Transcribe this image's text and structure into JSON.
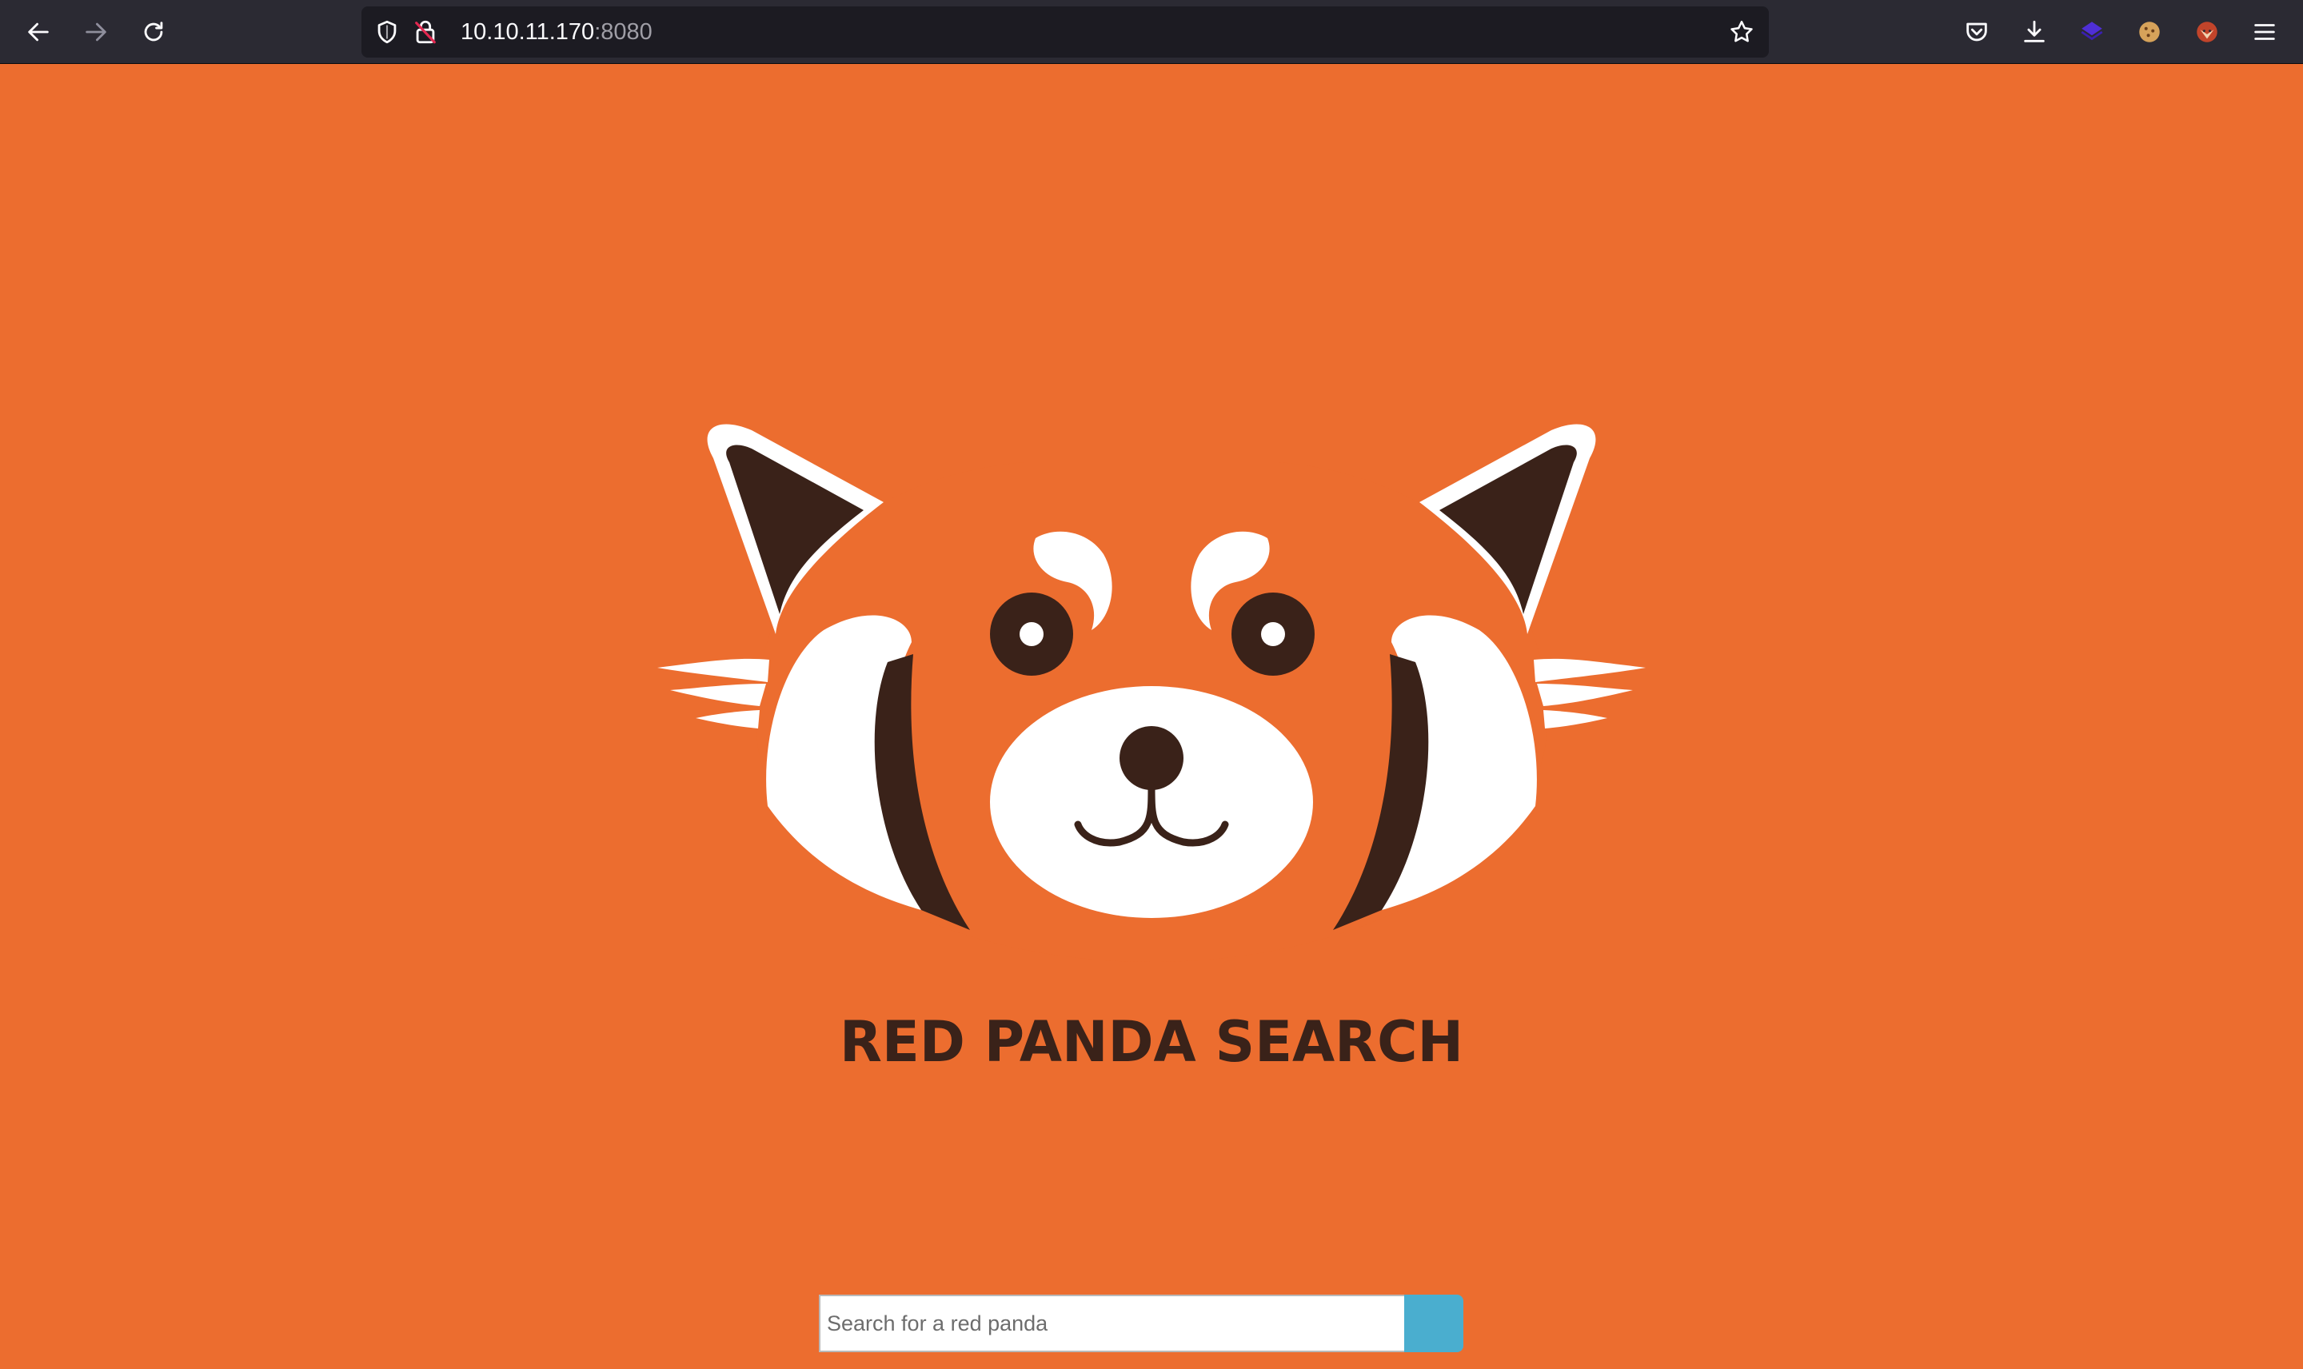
{
  "browser": {
    "url_host": "10.10.11.170",
    "url_port": ":8080",
    "icons": {
      "back": "back-arrow-icon",
      "forward": "forward-arrow-icon",
      "reload": "reload-icon",
      "shield": "tracking-protection-shield-icon",
      "insecure": "insecure-connection-lock-icon",
      "bookmark": "bookmark-star-icon",
      "pocket": "pocket-icon",
      "downloads": "downloads-icon",
      "ext1": "extension-icon",
      "ext2": "cookie-icon",
      "ext3": "fox-extension-icon",
      "menu": "hamburger-menu-icon"
    }
  },
  "page": {
    "title": "RED PANDA SEARCH",
    "search": {
      "placeholder": "Search for a red panda",
      "value": ""
    },
    "colors": {
      "background": "#ec6d2f",
      "dark_brown": "#3a2219",
      "title_brown": "#7a3c26",
      "white": "#ffffff",
      "button": "#4aaecf"
    }
  }
}
